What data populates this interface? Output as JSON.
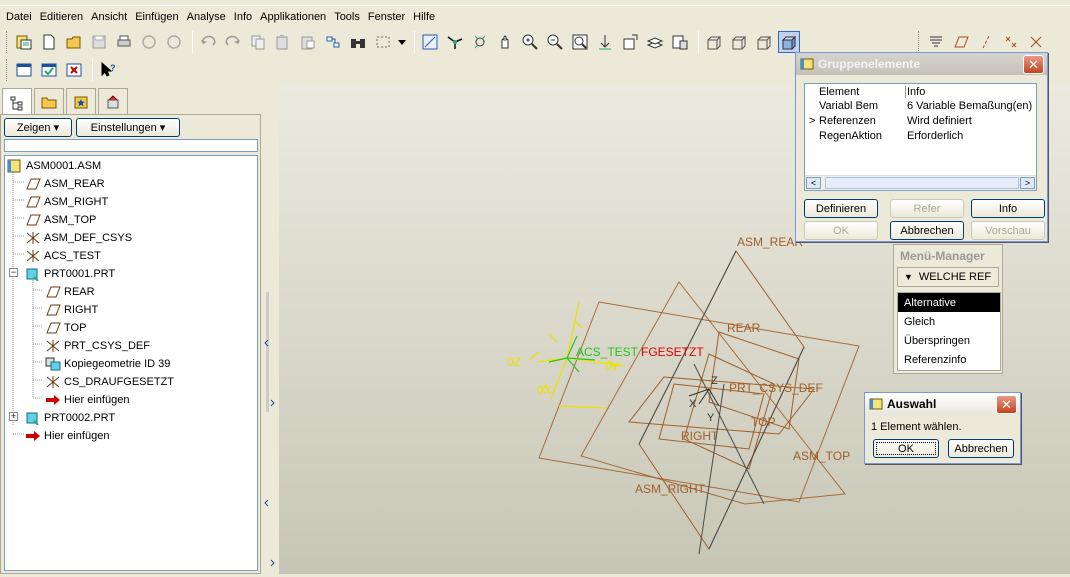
{
  "menubar": [
    "Datei",
    "Editieren",
    "Ansicht",
    "Einfügen",
    "Analyse",
    "Info",
    "Applikationen",
    "Tools",
    "Fenster",
    "Hilfe"
  ],
  "navigator": {
    "show_button": "Zeigen ▾",
    "settings_button": "Einstellungen ▾",
    "tree": [
      {
        "label": "ASM0001.ASM",
        "icon": "assembly-icon"
      },
      {
        "label": "ASM_REAR",
        "icon": "datum-plane-icon"
      },
      {
        "label": "ASM_RIGHT",
        "icon": "datum-plane-icon"
      },
      {
        "label": "ASM_TOP",
        "icon": "datum-plane-icon"
      },
      {
        "label": "ASM_DEF_CSYS",
        "icon": "csys-icon"
      },
      {
        "label": "ACS_TEST",
        "icon": "csys-icon"
      },
      {
        "label": "PRT0001.PRT",
        "icon": "part-icon"
      },
      {
        "label": "REAR",
        "icon": "datum-plane-icon"
      },
      {
        "label": "RIGHT",
        "icon": "datum-plane-icon"
      },
      {
        "label": "TOP",
        "icon": "datum-plane-icon"
      },
      {
        "label": "PRT_CSYS_DEF",
        "icon": "csys-icon"
      },
      {
        "label": "Kopiegeometrie ID 39",
        "icon": "copy-geometry-icon"
      },
      {
        "label": "CS_DRAUFGESETZT",
        "icon": "csys-icon"
      },
      {
        "label": "Hier einfügen",
        "icon": "insert-arrow-icon"
      },
      {
        "label": "PRT0002.PRT",
        "icon": "part-icon"
      },
      {
        "label": "Hier einfügen",
        "icon": "insert-arrow-icon"
      }
    ]
  },
  "graphics": {
    "labels": {
      "asm_rear": "ASM_REAR",
      "rear": "REAR",
      "prt_csys_def": "PRT_CSYS_DEF",
      "top": "TOP",
      "right": "RIGHT",
      "asm_top": "ASM_TOP",
      "asm_right": "ASM_RIGHT",
      "acs_test": "ACS_TEST",
      "fgesetzt": "FGESETZT",
      "z": "Z",
      "x": "X",
      "y": "Y",
      "oz": "0Z",
      "oy": "0Y",
      "ox": "0X"
    }
  },
  "group_dialog": {
    "title": "Gruppenelemente",
    "col_element": "Element",
    "col_info": "Info",
    "rows": [
      {
        "marker": "",
        "element": "Variabl Bem",
        "info": "6 Variable Bemaßung(en)"
      },
      {
        "marker": ">",
        "element": "Referenzen",
        "info": "Wird definiert"
      },
      {
        "marker": "",
        "element": "RegenAktion",
        "info": "Erforderlich"
      }
    ],
    "buttons": {
      "define": "Definieren",
      "refer": "Refer",
      "info": "Info",
      "ok": "OK",
      "cancel": "Abbrechen",
      "preview": "Vorschau"
    }
  },
  "menu_manager": {
    "title": "Menü-Manager",
    "submenu": "WELCHE REF",
    "items": [
      "Alternative",
      "Gleich",
      "Überspringen",
      "Referenzinfo"
    ]
  },
  "selection_dialog": {
    "title": "Auswahl",
    "message": "1 Element wählen.",
    "ok": "OK",
    "cancel": "Abbrechen"
  }
}
